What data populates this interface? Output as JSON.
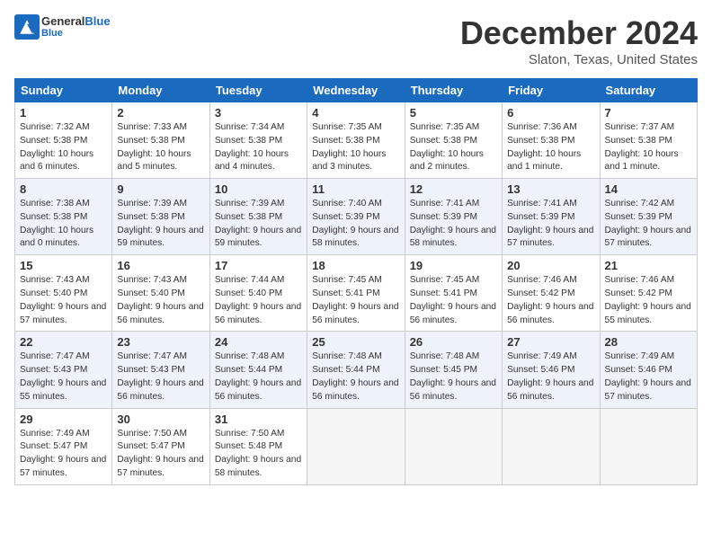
{
  "header": {
    "logo_general": "General",
    "logo_blue": "Blue",
    "title": "December 2024",
    "location": "Slaton, Texas, United States"
  },
  "weekdays": [
    "Sunday",
    "Monday",
    "Tuesday",
    "Wednesday",
    "Thursday",
    "Friday",
    "Saturday"
  ],
  "weeks": [
    [
      {
        "day": 1,
        "sunrise": "7:32 AM",
        "sunset": "5:38 PM",
        "daylight": "10 hours and 6 minutes."
      },
      {
        "day": 2,
        "sunrise": "7:33 AM",
        "sunset": "5:38 PM",
        "daylight": "10 hours and 5 minutes."
      },
      {
        "day": 3,
        "sunrise": "7:34 AM",
        "sunset": "5:38 PM",
        "daylight": "10 hours and 4 minutes."
      },
      {
        "day": 4,
        "sunrise": "7:35 AM",
        "sunset": "5:38 PM",
        "daylight": "10 hours and 3 minutes."
      },
      {
        "day": 5,
        "sunrise": "7:35 AM",
        "sunset": "5:38 PM",
        "daylight": "10 hours and 2 minutes."
      },
      {
        "day": 6,
        "sunrise": "7:36 AM",
        "sunset": "5:38 PM",
        "daylight": "10 hours and 1 minute."
      },
      {
        "day": 7,
        "sunrise": "7:37 AM",
        "sunset": "5:38 PM",
        "daylight": "10 hours and 1 minute."
      }
    ],
    [
      {
        "day": 8,
        "sunrise": "7:38 AM",
        "sunset": "5:38 PM",
        "daylight": "10 hours and 0 minutes."
      },
      {
        "day": 9,
        "sunrise": "7:39 AM",
        "sunset": "5:38 PM",
        "daylight": "9 hours and 59 minutes."
      },
      {
        "day": 10,
        "sunrise": "7:39 AM",
        "sunset": "5:38 PM",
        "daylight": "9 hours and 59 minutes."
      },
      {
        "day": 11,
        "sunrise": "7:40 AM",
        "sunset": "5:39 PM",
        "daylight": "9 hours and 58 minutes."
      },
      {
        "day": 12,
        "sunrise": "7:41 AM",
        "sunset": "5:39 PM",
        "daylight": "9 hours and 58 minutes."
      },
      {
        "day": 13,
        "sunrise": "7:41 AM",
        "sunset": "5:39 PM",
        "daylight": "9 hours and 57 minutes."
      },
      {
        "day": 14,
        "sunrise": "7:42 AM",
        "sunset": "5:39 PM",
        "daylight": "9 hours and 57 minutes."
      }
    ],
    [
      {
        "day": 15,
        "sunrise": "7:43 AM",
        "sunset": "5:40 PM",
        "daylight": "9 hours and 57 minutes."
      },
      {
        "day": 16,
        "sunrise": "7:43 AM",
        "sunset": "5:40 PM",
        "daylight": "9 hours and 56 minutes."
      },
      {
        "day": 17,
        "sunrise": "7:44 AM",
        "sunset": "5:40 PM",
        "daylight": "9 hours and 56 minutes."
      },
      {
        "day": 18,
        "sunrise": "7:45 AM",
        "sunset": "5:41 PM",
        "daylight": "9 hours and 56 minutes."
      },
      {
        "day": 19,
        "sunrise": "7:45 AM",
        "sunset": "5:41 PM",
        "daylight": "9 hours and 56 minutes."
      },
      {
        "day": 20,
        "sunrise": "7:46 AM",
        "sunset": "5:42 PM",
        "daylight": "9 hours and 56 minutes."
      },
      {
        "day": 21,
        "sunrise": "7:46 AM",
        "sunset": "5:42 PM",
        "daylight": "9 hours and 55 minutes."
      }
    ],
    [
      {
        "day": 22,
        "sunrise": "7:47 AM",
        "sunset": "5:43 PM",
        "daylight": "9 hours and 55 minutes."
      },
      {
        "day": 23,
        "sunrise": "7:47 AM",
        "sunset": "5:43 PM",
        "daylight": "9 hours and 56 minutes."
      },
      {
        "day": 24,
        "sunrise": "7:48 AM",
        "sunset": "5:44 PM",
        "daylight": "9 hours and 56 minutes."
      },
      {
        "day": 25,
        "sunrise": "7:48 AM",
        "sunset": "5:44 PM",
        "daylight": "9 hours and 56 minutes."
      },
      {
        "day": 26,
        "sunrise": "7:48 AM",
        "sunset": "5:45 PM",
        "daylight": "9 hours and 56 minutes."
      },
      {
        "day": 27,
        "sunrise": "7:49 AM",
        "sunset": "5:46 PM",
        "daylight": "9 hours and 56 minutes."
      },
      {
        "day": 28,
        "sunrise": "7:49 AM",
        "sunset": "5:46 PM",
        "daylight": "9 hours and 57 minutes."
      }
    ],
    [
      {
        "day": 29,
        "sunrise": "7:49 AM",
        "sunset": "5:47 PM",
        "daylight": "9 hours and 57 minutes."
      },
      {
        "day": 30,
        "sunrise": "7:50 AM",
        "sunset": "5:47 PM",
        "daylight": "9 hours and 57 minutes."
      },
      {
        "day": 31,
        "sunrise": "7:50 AM",
        "sunset": "5:48 PM",
        "daylight": "9 hours and 58 minutes."
      },
      null,
      null,
      null,
      null
    ]
  ]
}
